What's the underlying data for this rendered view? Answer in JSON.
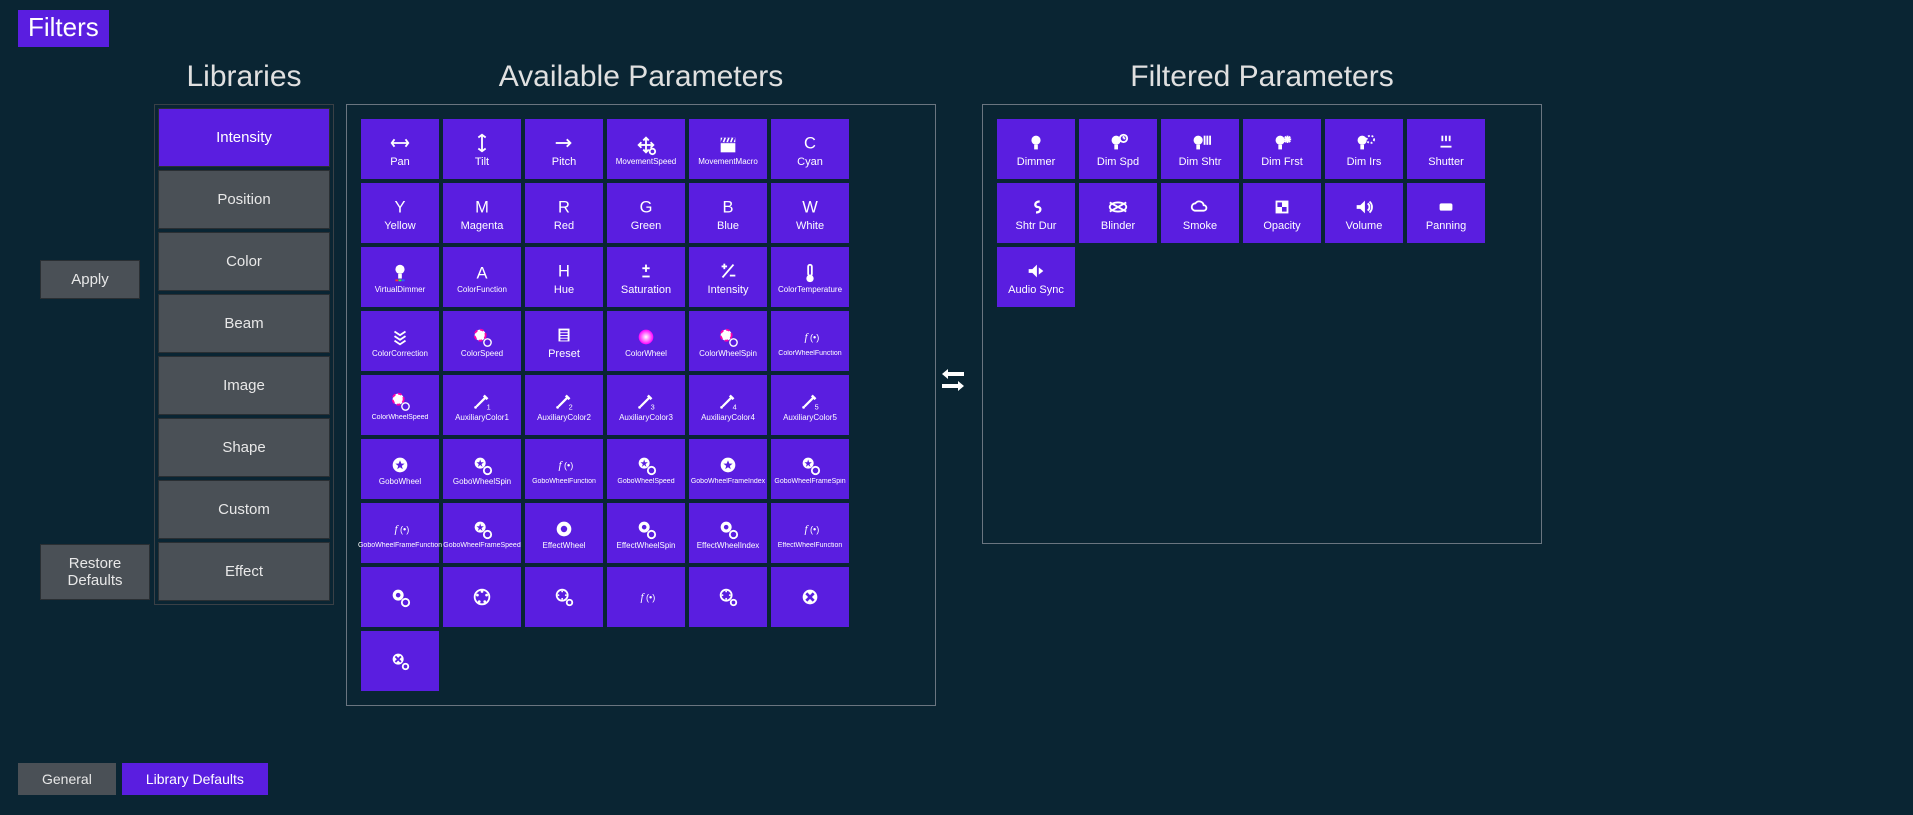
{
  "title": "Filters",
  "headings": {
    "libraries": "Libraries",
    "available": "Available Parameters",
    "filtered": "Filtered Parameters"
  },
  "actions": {
    "apply": "Apply",
    "restore": "Restore Defaults"
  },
  "libraries": {
    "active": 0,
    "items": [
      "Intensity",
      "Position",
      "Color",
      "Beam",
      "Image",
      "Shape",
      "Custom",
      "Effect"
    ]
  },
  "available": [
    {
      "label": "Pan",
      "icon": "↔"
    },
    {
      "label": "Tilt",
      "icon": "↕"
    },
    {
      "label": "Pitch",
      "icon": "→"
    },
    {
      "label": "MovementSpeed",
      "icon": "move-speed",
      "long": true
    },
    {
      "label": "MovementMacro",
      "icon": "clapper",
      "long": true
    },
    {
      "label": "Cyan",
      "icon": "C"
    },
    {
      "label": "Yellow",
      "icon": "Y"
    },
    {
      "label": "Magenta",
      "icon": "M"
    },
    {
      "label": "Red",
      "icon": "R"
    },
    {
      "label": "Green",
      "icon": "G"
    },
    {
      "label": "Blue",
      "icon": "B"
    },
    {
      "label": "White",
      "icon": "W"
    },
    {
      "label": "VirtualDimmer",
      "icon": "bulb-rgb",
      "long": true
    },
    {
      "label": "ColorFunction",
      "icon": "A",
      "long": true
    },
    {
      "label": "Hue",
      "icon": "H"
    },
    {
      "label": "Saturation",
      "icon": "±"
    },
    {
      "label": "Intensity",
      "icon": "±/"
    },
    {
      "label": "ColorTemperature",
      "icon": "thermo",
      "long": true
    },
    {
      "label": "ColorCorrection",
      "icon": "chevrons",
      "long": true
    },
    {
      "label": "ColorSpeed",
      "icon": "wheel-speed",
      "long": true
    },
    {
      "label": "Preset",
      "icon": "list"
    },
    {
      "label": "ColorWheel",
      "icon": "wheel",
      "long": true
    },
    {
      "label": "ColorWheelSpin",
      "icon": "wheel-spin",
      "long": true
    },
    {
      "label": "ColorWheelFunction",
      "icon": "fn-wheel",
      "xs": true
    },
    {
      "label": "ColorWheelSpeed",
      "icon": "wheel-clock",
      "xs": true
    },
    {
      "label": "AuxiliaryColor1",
      "icon": "dropper-1",
      "long": true
    },
    {
      "label": "AuxiliaryColor2",
      "icon": "dropper-2",
      "long": true
    },
    {
      "label": "AuxiliaryColor3",
      "icon": "dropper-3",
      "long": true
    },
    {
      "label": "AuxiliaryColor4",
      "icon": "dropper-4",
      "long": true
    },
    {
      "label": "AuxiliaryColor5",
      "icon": "dropper-5",
      "long": true
    },
    {
      "label": "GoboWheel",
      "icon": "star-circ",
      "long": true
    },
    {
      "label": "GoboWheelSpin",
      "icon": "star-spin",
      "long": true
    },
    {
      "label": "GoboWheelFunction",
      "icon": "fn-star",
      "xs": true
    },
    {
      "label": "GoboWheelSpeed",
      "icon": "star-clock",
      "xs": true
    },
    {
      "label": "GoboWheelFrameIndex",
      "icon": "star-idx",
      "xs": true
    },
    {
      "label": "GoboWheelFrameSpin",
      "icon": "star-fspin",
      "xs": true
    },
    {
      "label": "GoboWheelFrameFunction",
      "icon": "fn-star2",
      "xs": true
    },
    {
      "label": "GoboWheelFrameSpeed",
      "icon": "star-fspd",
      "xs": true
    },
    {
      "label": "EffectWheel",
      "icon": "ring",
      "long": true
    },
    {
      "label": "EffectWheelSpin",
      "icon": "ring-spin",
      "long": true
    },
    {
      "label": "EffectWheelIndex",
      "icon": "ring-idx",
      "long": true
    },
    {
      "label": "EffectWheelFunction",
      "icon": "fn-ring",
      "xs": true
    },
    {
      "label": "",
      "icon": "ring-clock"
    },
    {
      "label": "",
      "icon": "reel"
    },
    {
      "label": "",
      "icon": "reel-spin"
    },
    {
      "label": "",
      "icon": "fn-reel"
    },
    {
      "label": "",
      "icon": "reel-dot"
    },
    {
      "label": "",
      "icon": "x-circ"
    },
    {
      "label": "",
      "icon": "x-spin"
    }
  ],
  "filtered": [
    {
      "label": "Dimmer",
      "icon": "bulb"
    },
    {
      "label": "Dim Spd",
      "icon": "bulb-clock"
    },
    {
      "label": "Dim Shtr",
      "icon": "bulb-shtr"
    },
    {
      "label": "Dim Frst",
      "icon": "bulb-frost"
    },
    {
      "label": "Dim Irs",
      "icon": "bulb-iris"
    },
    {
      "label": "Shutter",
      "icon": "shutter"
    },
    {
      "label": "Shtr Dur",
      "icon": "s-dur"
    },
    {
      "label": "Blinder",
      "icon": "blinder"
    },
    {
      "label": "Smoke",
      "icon": "cloud"
    },
    {
      "label": "Opacity",
      "icon": "opacity"
    },
    {
      "label": "Volume",
      "icon": "volume"
    },
    {
      "label": "Panning",
      "icon": "panning"
    },
    {
      "label": "Audio Sync",
      "icon": "audio-sync"
    }
  ],
  "tabs": {
    "active": 1,
    "items": [
      "General",
      "Library Defaults"
    ]
  }
}
